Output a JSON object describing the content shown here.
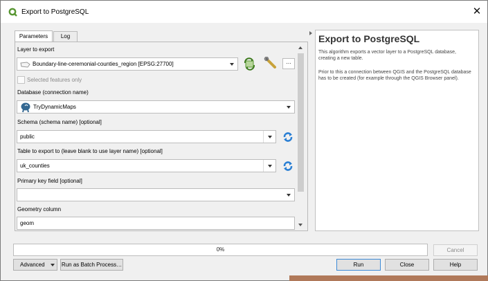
{
  "window": {
    "title": "Export to PostgreSQL",
    "close_glyph": "✕"
  },
  "tabs": [
    {
      "label": "Parameters",
      "active": true
    },
    {
      "label": "Log",
      "active": false
    }
  ],
  "form": {
    "layer_label": "Layer to export",
    "layer_value": "Boundary-line-ceremonial-counties_region [EPSG:27700]",
    "layer_more_button": "…",
    "selected_only_label": "Selected features only",
    "selected_only_checked": false,
    "database_label": "Database (connection name)",
    "database_value": "TryDynamicMaps",
    "schema_label": "Schema (schema name) [optional]",
    "schema_value": "public",
    "table_label": "Table to export to (leave blank to use layer name) [optional]",
    "table_value": "uk_counties",
    "pk_label": "Primary key field [optional]",
    "pk_value": "",
    "geom_label": "Geometry column",
    "geom_value": "geom"
  },
  "help": {
    "title": "Export to PostgreSQL",
    "p1": "This algorithm exports a vector layer to a PostgreSQL database, creating a new table.",
    "p2": "Prior to this a connection between QGIS and the PostgreSQL database has to be created (for example through the QGIS Browser panel)."
  },
  "progress": {
    "text": "0%",
    "value": 0
  },
  "buttons": {
    "cancel": "Cancel",
    "advanced": "Advanced",
    "batch": "Run as Batch Process…",
    "run": "Run",
    "close": "Close",
    "help": "Help"
  },
  "icons": {
    "app": "qgis-logo-icon",
    "layer": "polygon-layer-icon",
    "database": "postgresql-elephant-icon",
    "iterate": "iterate-features-icon",
    "settings": "wrench-settings-icon",
    "refresh": "refresh-icon"
  },
  "colors": {
    "qgis_green": "#589632",
    "refresh_blue": "#2a7fd4",
    "run_border": "#3c8ad6"
  }
}
